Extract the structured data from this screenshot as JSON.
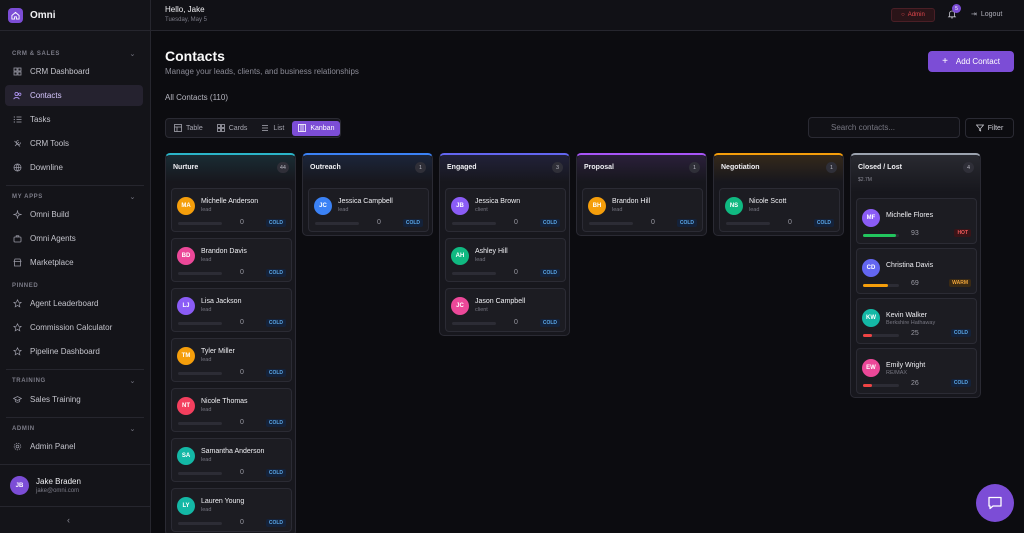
{
  "brand": {
    "name": "Omni"
  },
  "sidebar": {
    "sections": [
      {
        "title": "CRM & SALES"
      },
      {
        "title": "MY APPS"
      },
      {
        "title": "PINNED"
      },
      {
        "title": "TRAINING"
      },
      {
        "title": "ADMIN"
      }
    ],
    "items": [
      {
        "label": "CRM Dashboard",
        "icon": "grid-icon"
      },
      {
        "label": "Contacts",
        "icon": "users-icon",
        "active": true
      },
      {
        "label": "Tasks",
        "icon": "tasks-icon"
      },
      {
        "label": "CRM Tools",
        "icon": "tools-icon"
      },
      {
        "label": "Downline",
        "icon": "downline-icon"
      },
      {
        "label": "Omni Build",
        "icon": "sparkles-icon"
      },
      {
        "label": "Omni Agents",
        "icon": "briefcase-icon"
      },
      {
        "label": "Marketplace",
        "icon": "store-icon"
      },
      {
        "label": "Agent Leaderboard",
        "icon": "star-icon"
      },
      {
        "label": "Commission Calculator",
        "icon": "star-icon"
      },
      {
        "label": "Pipeline Dashboard",
        "icon": "star-icon"
      },
      {
        "label": "Sales Training",
        "icon": "graduation-icon"
      },
      {
        "label": "Admin Panel",
        "icon": "gear-icon"
      }
    ],
    "user": {
      "initials": "JB",
      "name": "Jake Braden",
      "email": "jake@omni.com"
    }
  },
  "topbar": {
    "greeting": "Hello, Jake",
    "date": "Tuesday, May 5",
    "admin_label": "Admin",
    "notif_count": "5",
    "logout_label": "Logout"
  },
  "page": {
    "title": "Contacts",
    "subtitle": "Manage your leads, clients, and business relationships",
    "add_label": "Add Contact",
    "count_label": "All Contacts (110)",
    "views": [
      {
        "label": "Table"
      },
      {
        "label": "Cards"
      },
      {
        "label": "List"
      },
      {
        "label": "Kanban",
        "active": true
      }
    ],
    "search_placeholder": "Search contacts...",
    "filter_label": "Filter"
  },
  "colors": {
    "accent": "#7c4dd6",
    "nurture": "#2bb5c9",
    "outreach": "#3b82f6",
    "engaged": "#6366f1",
    "proposal": "#a855f7",
    "negotiation": "#f59e0b",
    "closed": "#9ca3af"
  },
  "columns": [
    {
      "name": "Nurture",
      "count": "44",
      "cards": [
        {
          "initials": "MA",
          "name": "Michelle Anderson",
          "status": "lead",
          "score": "0",
          "tag": "COLD",
          "color": "#f59e0b"
        },
        {
          "initials": "BD",
          "name": "Brandon Davis",
          "status": "lead",
          "score": "0",
          "tag": "COLD",
          "color": "#ec4899"
        },
        {
          "initials": "LJ",
          "name": "Lisa Jackson",
          "status": "lead",
          "score": "0",
          "tag": "COLD",
          "color": "#8b5cf6"
        },
        {
          "initials": "TM",
          "name": "Tyler Miller",
          "status": "lead",
          "score": "0",
          "tag": "COLD",
          "color": "#f59e0b"
        },
        {
          "initials": "NT",
          "name": "Nicole Thomas",
          "status": "lead",
          "score": "0",
          "tag": "COLD",
          "color": "#f43f5e"
        },
        {
          "initials": "SA",
          "name": "Samantha Anderson",
          "status": "lead",
          "score": "0",
          "tag": "COLD",
          "color": "#14b8a6"
        },
        {
          "initials": "LY",
          "name": "Lauren Young",
          "status": "lead",
          "score": "0",
          "tag": "COLD",
          "color": "#14b8a6"
        }
      ]
    },
    {
      "name": "Outreach",
      "count": "1",
      "cards": [
        {
          "initials": "JC",
          "name": "Jessica Campbell",
          "status": "lead",
          "score": "0",
          "tag": "COLD",
          "color": "#3b82f6"
        }
      ]
    },
    {
      "name": "Engaged",
      "count": "3",
      "cards": [
        {
          "initials": "JB",
          "name": "Jessica Brown",
          "status": "client",
          "score": "0",
          "tag": "COLD",
          "color": "#8b5cf6"
        },
        {
          "initials": "AH",
          "name": "Ashley Hill",
          "status": "lead",
          "score": "0",
          "tag": "COLD",
          "color": "#10b981"
        },
        {
          "initials": "JC",
          "name": "Jason Campbell",
          "status": "client",
          "score": "0",
          "tag": "COLD",
          "color": "#ec4899"
        }
      ]
    },
    {
      "name": "Proposal",
      "count": "1",
      "cards": [
        {
          "initials": "BH",
          "name": "Brandon Hill",
          "status": "lead",
          "score": "0",
          "tag": "COLD",
          "color": "#f59e0b"
        }
      ]
    },
    {
      "name": "Negotiation",
      "count": "1",
      "cards": [
        {
          "initials": "NS",
          "name": "Nicole Scott",
          "status": "lead",
          "score": "0",
          "tag": "COLD",
          "color": "#10b981"
        }
      ]
    },
    {
      "name": "Closed / Lost",
      "count": "4",
      "sub": "$2.7M",
      "cards": [
        {
          "initials": "MF",
          "name": "Michelle Flores",
          "status": "",
          "score": "93",
          "progress": 0.93,
          "tag": "HOT",
          "color": "#8b5cf6",
          "bar_color": "#22c55e"
        },
        {
          "initials": "CD",
          "name": "Christina Davis",
          "status": "",
          "score": "69",
          "progress": 0.69,
          "tag": "WARM",
          "color": "#6366f1",
          "bar_color": "#f59e0b"
        },
        {
          "initials": "KW",
          "name": "Kevin Walker",
          "status": "Berkshire Hathaway",
          "score": "25",
          "progress": 0.25,
          "tag": "COLD",
          "color": "#14b8a6",
          "bar_color": "#ef4444"
        },
        {
          "initials": "EW",
          "name": "Emily Wright",
          "status": "RE/MAX",
          "score": "26",
          "progress": 0.26,
          "tag": "COLD",
          "color": "#ec4899",
          "bar_color": "#ef4444"
        }
      ]
    }
  ]
}
